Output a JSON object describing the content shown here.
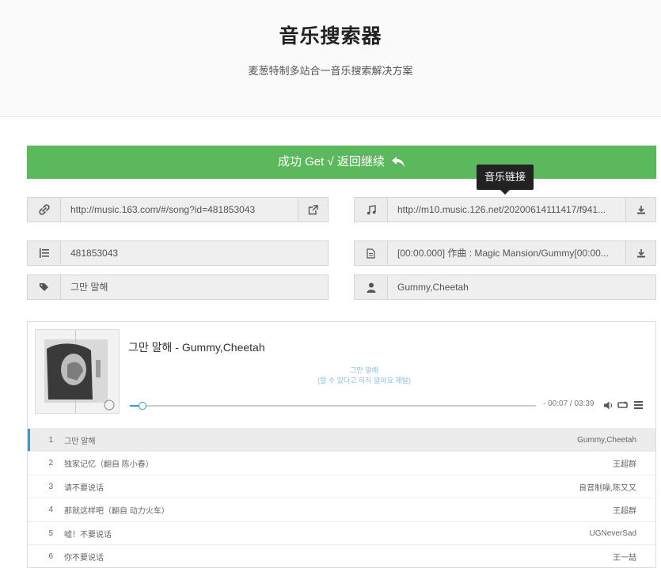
{
  "header": {
    "title": "音乐搜索器",
    "subtitle": "麦葱特制多站合一音乐搜索解决方案"
  },
  "success_bar": {
    "label": "成功 Get √ 返回继续"
  },
  "tooltip": "音乐链接",
  "fields": {
    "song_url": "http://music.163.com/#/song?id=481853043",
    "audio_url": "http://m10.music.126.net/20200614111417/f941...",
    "song_id": "481853043",
    "lyrics_text": "[00:00.000] 作曲 : Magic Mansion/Gummy[00:00...",
    "song_name": "그만 말해",
    "artist": "Gummy,Cheetah"
  },
  "player": {
    "track_title": "그만 말해 - Gummy,Cheetah",
    "lyric_line1": "그만 말해",
    "lyric_line2": "(할 수 있다고 하지 말아요 제발)",
    "time": "- 00:07 / 03:39",
    "progress": 0.032
  },
  "playlist": [
    {
      "num": "1",
      "name": "그만 말해",
      "artist": "Gummy,Cheetah",
      "active": true
    },
    {
      "num": "2",
      "name": "独家记忆（翻自 陈小春）",
      "artist": "王超群",
      "active": false
    },
    {
      "num": "3",
      "name": "请不要说话",
      "artist": "良音制噪,陈又又",
      "active": false
    },
    {
      "num": "4",
      "name": "那就这样吧（翻自 动力火车）",
      "artist": "王超群",
      "active": false
    },
    {
      "num": "5",
      "name": "嘘！不要说话",
      "artist": "UGNeverSad",
      "active": false
    },
    {
      "num": "6",
      "name": "你不要说话",
      "artist": "王一喆",
      "active": false
    }
  ],
  "colors": {
    "success": "#5cb85c",
    "accent": "#2b9cd8",
    "tooltip_bg": "#222222"
  },
  "icons": {
    "song_url": "link-icon",
    "open": "external-link-icon",
    "audio_url": "music-note-icon",
    "download": "download-icon",
    "song_id": "list-icon",
    "lyrics": "file-text-icon",
    "song_name": "tag-icon",
    "artist": "user-icon",
    "back": "reply-arrow-icon"
  }
}
